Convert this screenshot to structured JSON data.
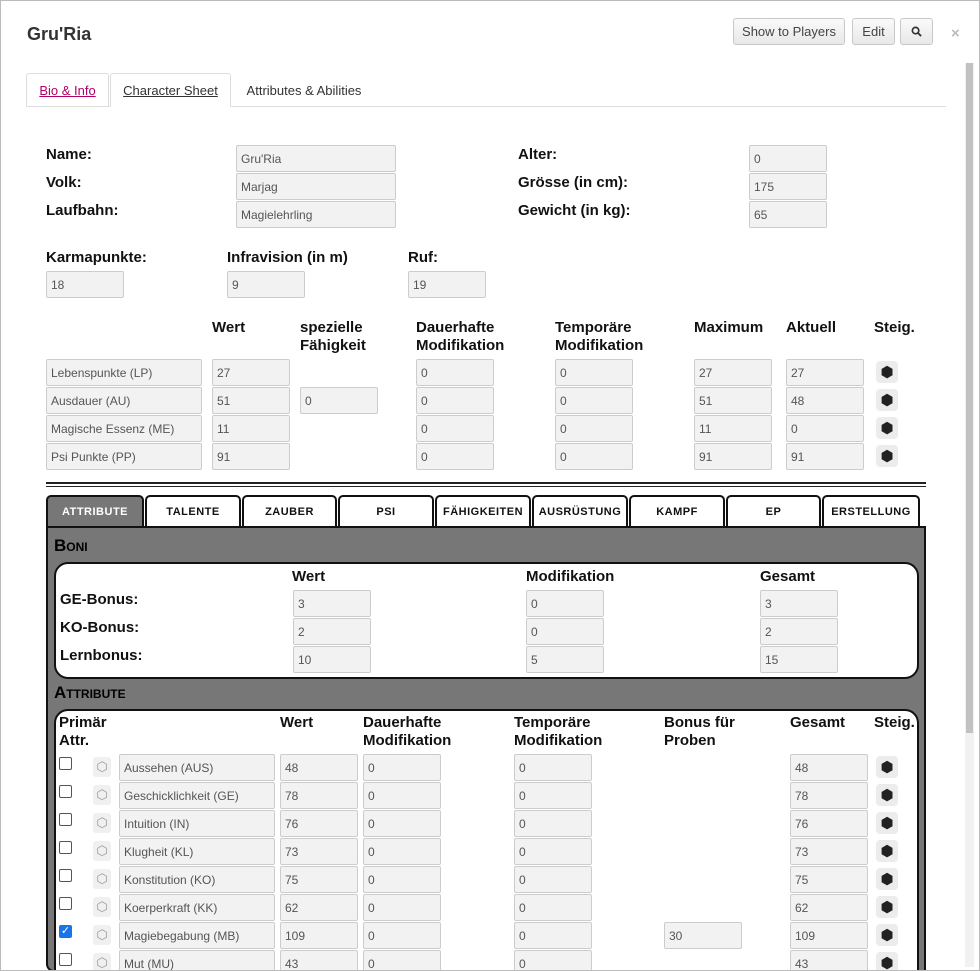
{
  "window": {
    "title": "Gru'Ria",
    "show_to_players": "Show to Players",
    "edit": "Edit",
    "search_icon": "search-icon",
    "close": "×"
  },
  "tabs": [
    "Bio & Info",
    "Character Sheet",
    "Attributes & Abilities"
  ],
  "basics": {
    "name_label": "Name:",
    "name": "Gru'Ria",
    "volk_label": "Volk:",
    "volk": "Marjag",
    "laufbahn_label": "Laufbahn:",
    "laufbahn": "Magielehrling",
    "alter_label": "Alter:",
    "alter": "0",
    "groesse_label": "Grösse (in cm):",
    "groesse": "175",
    "gewicht_label": "Gewicht (in kg):",
    "gewicht": "65",
    "karma_label": "Karmapunkte:",
    "karma": "18",
    "infra_label": "Infravision (in m)",
    "infra": "9",
    "ruf_label": "Ruf:",
    "ruf": "19"
  },
  "resources": {
    "headers": {
      "wert": "Wert",
      "spez": "spezielle Fähigkeit",
      "dauer": "Dauerhafte Modifikation",
      "temp": "Temporäre Modifikation",
      "max": "Maximum",
      "akt": "Aktuell",
      "steig": "Steig."
    },
    "rows": [
      {
        "name": "Lebenspunkte (LP)",
        "wert": "27",
        "spez": "",
        "dauer": "0",
        "temp": "0",
        "max": "27",
        "akt": "27"
      },
      {
        "name": "Ausdauer (AU)",
        "wert": "51",
        "spez": "0",
        "dauer": "0",
        "temp": "0",
        "max": "51",
        "akt": "48"
      },
      {
        "name": "Magische Essenz (ME)",
        "wert": "11",
        "spez": "",
        "dauer": "0",
        "temp": "0",
        "max": "11",
        "akt": "0"
      },
      {
        "name": "Psi Punkte (PP)",
        "wert": "91",
        "spez": "",
        "dauer": "0",
        "temp": "0",
        "max": "91",
        "akt": "91"
      }
    ]
  },
  "subtabs": [
    "ATTRIBUTE",
    "TALENTE",
    "ZAUBER",
    "PSI",
    "FÄHIGKEITEN",
    "AUSRÜSTUNG",
    "KAMPF",
    "EP",
    "ERSTELLUNG"
  ],
  "boni": {
    "title": "Boni",
    "headers": {
      "wert": "Wert",
      "mod": "Modifikation",
      "gesamt": "Gesamt"
    },
    "rows": [
      {
        "name": "GE-Bonus:",
        "wert": "3",
        "mod": "0",
        "gesamt": "3"
      },
      {
        "name": "KO-Bonus:",
        "wert": "2",
        "mod": "0",
        "gesamt": "2"
      },
      {
        "name": "Lernbonus:",
        "wert": "10",
        "mod": "5",
        "gesamt": "15"
      }
    ]
  },
  "attribute": {
    "title": "Attribute",
    "headers": {
      "primaer": "Primär Attr.",
      "wert": "Wert",
      "dauer": "Dauerhafte Modifikation",
      "temp": "Temporäre Modifikation",
      "bonus": "Bonus für Proben",
      "gesamt": "Gesamt",
      "steig": "Steig."
    },
    "rows": [
      {
        "name": "Aussehen (AUS)",
        "checked": false,
        "wert": "48",
        "dauer": "0",
        "temp": "0",
        "bonus": "",
        "gesamt": "48"
      },
      {
        "name": "Geschicklichkeit (GE)",
        "checked": false,
        "wert": "78",
        "dauer": "0",
        "temp": "0",
        "bonus": "",
        "gesamt": "78"
      },
      {
        "name": "Intuition (IN)",
        "checked": false,
        "wert": "76",
        "dauer": "0",
        "temp": "0",
        "bonus": "",
        "gesamt": "76"
      },
      {
        "name": "Klugheit (KL)",
        "checked": false,
        "wert": "73",
        "dauer": "0",
        "temp": "0",
        "bonus": "",
        "gesamt": "73"
      },
      {
        "name": "Konstitution (KO)",
        "checked": false,
        "wert": "75",
        "dauer": "0",
        "temp": "0",
        "bonus": "",
        "gesamt": "75"
      },
      {
        "name": "Koerperkraft (KK)",
        "checked": false,
        "wert": "62",
        "dauer": "0",
        "temp": "0",
        "bonus": "",
        "gesamt": "62"
      },
      {
        "name": "Magiebegabung (MB)",
        "checked": true,
        "wert": "109",
        "dauer": "0",
        "temp": "0",
        "bonus": "30",
        "gesamt": "109"
      },
      {
        "name": "Mut (MU)",
        "checked": false,
        "wert": "43",
        "dauer": "0",
        "temp": "0",
        "bonus": "",
        "gesamt": "43"
      }
    ]
  },
  "colors": {
    "tab_link": "#b0006a",
    "panel_grey": "#777777",
    "checkbox": "#1a73e8"
  }
}
